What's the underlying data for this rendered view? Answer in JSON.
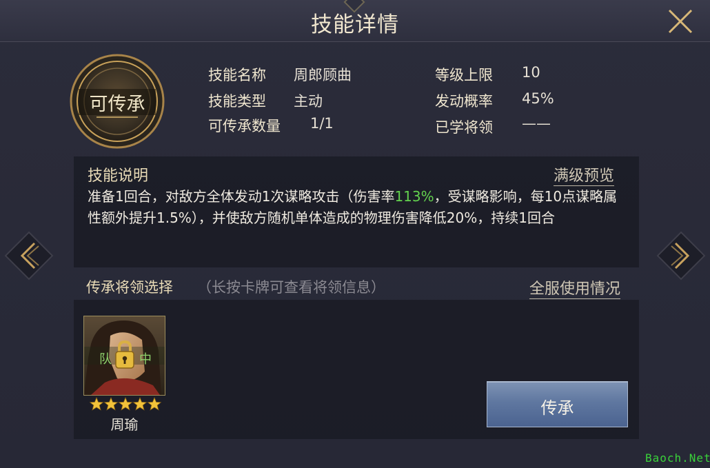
{
  "header": {
    "title": "技能详情"
  },
  "badge": {
    "label": "可传承"
  },
  "info": {
    "skill_name_label": "技能名称",
    "skill_name_value": "周郎顾曲",
    "skill_type_label": "技能类型",
    "skill_type_value": "主动",
    "inherit_count_label": "可传承数量",
    "inherit_count_value": "1/1",
    "level_cap_label": "等级上限",
    "level_cap_value": "10",
    "trigger_rate_label": "发动概率",
    "trigger_rate_value": "45%",
    "learned_label": "已学将领",
    "learned_value": "——"
  },
  "description": {
    "title": "技能说明",
    "max_preview_link": "满级预览",
    "text_before": "准备1回合，对敌方全体发动1次谋略攻击（伤害率",
    "highlight": "113%",
    "text_after": "，受谋略影响，每10点谋略属性额外提升1.5%），并使敌方随机单体造成的物理伤害降低20%，持续1回合"
  },
  "selection": {
    "title": "传承将领选择",
    "hint": "（长按卡牌可查看将领信息）",
    "server_usage_link": "全服使用情况"
  },
  "hero_card": {
    "name": "周瑜",
    "stars": 5,
    "overlay_left": "队",
    "overlay_right": "中",
    "lock_icon": "padlock-icon"
  },
  "actions": {
    "inherit_button": "传承"
  },
  "watermark": "Baoch.Net",
  "colors": {
    "highlight": "#63d14e",
    "gold": "#c9a25a",
    "button": "#5f77a0"
  }
}
